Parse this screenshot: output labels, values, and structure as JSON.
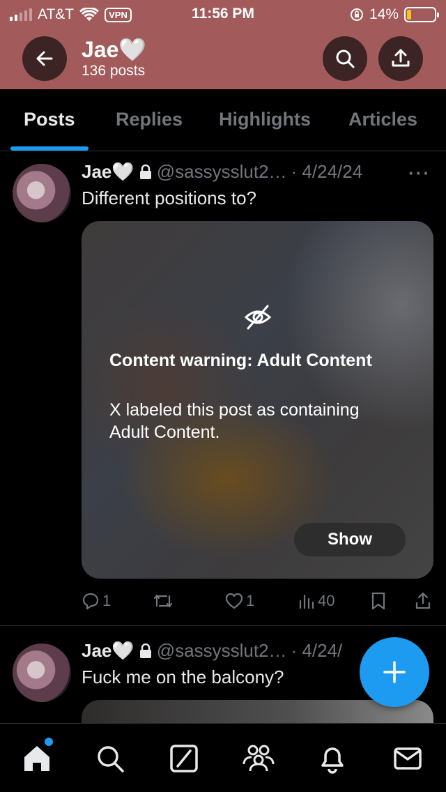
{
  "status_bar": {
    "carrier": "AT&T",
    "vpn": "VPN",
    "time": "11:56 PM",
    "battery": "14%"
  },
  "header": {
    "name": "Jae🤍",
    "posts_count": "136 posts"
  },
  "tabs": [
    {
      "label": "Posts",
      "active": true
    },
    {
      "label": "Replies",
      "active": false
    },
    {
      "label": "Highlights",
      "active": false
    },
    {
      "label": "Articles",
      "active": false
    }
  ],
  "posts": [
    {
      "name": "Jae🤍",
      "handle": "@sassysslut2…",
      "date": "· 4/24/24",
      "text": "Different positions to?",
      "content_warning": {
        "title": "Content warning: Adult Content",
        "body": "X labeled this post as containing Adult Content.",
        "button": "Show"
      },
      "replies": "1",
      "likes": "1",
      "views": "40"
    },
    {
      "name": "Jae🤍",
      "handle": "@sassysslut2…",
      "date": "· 4/24/",
      "text": "Fuck me on the balcony?"
    }
  ],
  "colors": {
    "header_bg": "#a35a5a",
    "accent": "#1d9bf0",
    "muted": "#71767b"
  },
  "icons": [
    "back-arrow-icon",
    "search-icon",
    "share-icon",
    "lock-icon",
    "eye-slash-icon",
    "reply-icon",
    "retweet-icon",
    "like-icon",
    "views-icon",
    "bookmark-icon",
    "home-icon",
    "explore-icon",
    "grok-icon",
    "communities-icon",
    "notifications-icon",
    "messages-icon",
    "plus-icon"
  ]
}
